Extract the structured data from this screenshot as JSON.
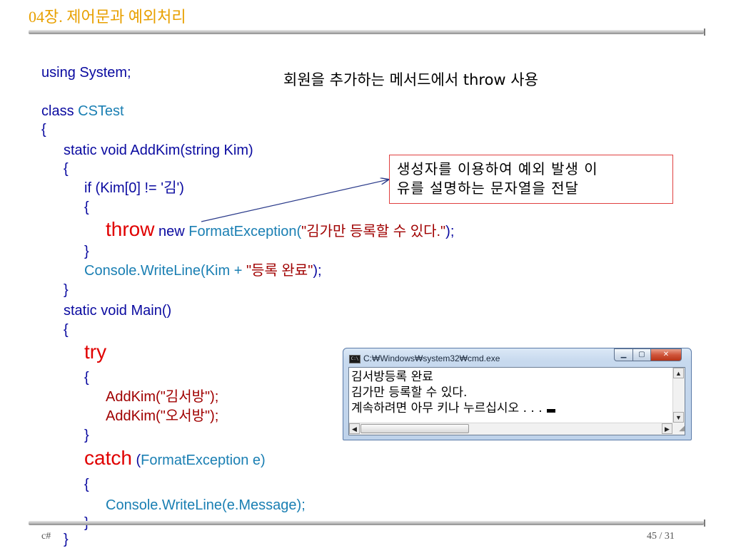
{
  "slide": {
    "title": "04장. 제어문과 예외처리",
    "footer_left": "c#",
    "page": "45 / 31"
  },
  "code": {
    "l1": "using System;",
    "l2a": "class ",
    "l2b": "CSTest",
    "l3": "{",
    "l4": "static void AddKim(string Kim)",
    "l5": "{",
    "l6": "if (Kim[0] != '김')",
    "l7": "{",
    "l8a": "throw",
    "l8b": " new ",
    "l8c": "FormatException(",
    "l8d": "\"김가만 등록할 수 있다.\"",
    "l8e": ");",
    "l9": "}",
    "l10a": "Console.WriteLine(Kim + ",
    "l10b": "\"등록 완료\"",
    "l10c": ");",
    "l11": "}",
    "l12": "static void Main()",
    "l13": "{",
    "l14": "try",
    "l15": "{",
    "l16": "AddKim(\"김서방\");",
    "l17": "AddKim(\"오서방\");",
    "l18": "}",
    "l19a": "catch",
    "l19b": " (",
    "l19c": "FormatException e)",
    "l20": "{",
    "l21": "Console.WriteLine(e.Message);",
    "l22": "}",
    "l23": "}"
  },
  "caption": "회원을 추가하는 메서드에서 throw 사용",
  "callout": {
    "line1": "생성자를 이용하여 예외 발생 이",
    "line2": "유를 설명하는 문자열을 전달"
  },
  "console": {
    "title": "C:₩Windows₩system32₩cmd.exe",
    "icon_label": "C:\\",
    "lines": [
      "김서방등록 완료",
      "김가만 등록할 수 있다.",
      "계속하려면 아무 키나 누르십시오 . . ."
    ],
    "min_icon": "minimize-icon",
    "max_icon": "maximize-icon",
    "close_icon": "close-icon"
  },
  "colors": {
    "title": "#e8a000",
    "code_blue": "#0a0aa0",
    "code_cyan": "#1a7fb3",
    "code_string": "#a00000",
    "keyword_red": "#e00000",
    "callout_border": "#e04040"
  }
}
